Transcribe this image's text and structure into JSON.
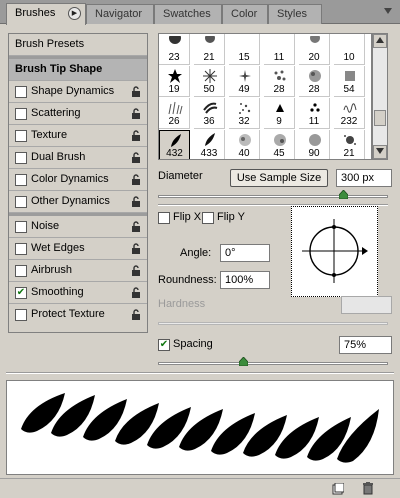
{
  "tabs": [
    {
      "label": "Brushes"
    },
    {
      "label": "Navigator"
    },
    {
      "label": "Swatches"
    },
    {
      "label": "Color"
    },
    {
      "label": "Styles"
    }
  ],
  "left_list": {
    "presets": "Brush Presets",
    "tip_shape": "Brush Tip Shape",
    "options": [
      {
        "label": "Shape Dynamics",
        "checked": false
      },
      {
        "label": "Scattering",
        "checked": false
      },
      {
        "label": "Texture",
        "checked": false
      },
      {
        "label": "Dual Brush",
        "checked": false
      },
      {
        "label": "Color Dynamics",
        "checked": false
      },
      {
        "label": "Other Dynamics",
        "checked": false
      }
    ],
    "options2": [
      {
        "label": "Noise",
        "checked": false
      },
      {
        "label": "Wet Edges",
        "checked": false
      },
      {
        "label": "Airbrush",
        "checked": false
      },
      {
        "label": "Smoothing",
        "checked": true
      },
      {
        "label": "Protect Texture",
        "checked": false
      }
    ]
  },
  "brush_grid": {
    "rows": [
      [
        "23",
        "21",
        "15",
        "11",
        "20",
        "10"
      ],
      [
        "19",
        "50",
        "49",
        "28",
        "28",
        "54"
      ],
      [
        "26",
        "36",
        "32",
        "9",
        "11",
        "232"
      ],
      [
        "432",
        "433",
        "40",
        "45",
        "90",
        "21"
      ]
    ],
    "selected": "432"
  },
  "diameter": {
    "label": "Diameter",
    "button": "Use Sample Size",
    "value": "300 px"
  },
  "flip_x": "Flip X",
  "flip_y": "Flip Y",
  "angle": {
    "label": "Angle:",
    "value": "0°"
  },
  "roundness": {
    "label": "Roundness:",
    "value": "100%"
  },
  "hardness": {
    "label": "Hardness",
    "value": ""
  },
  "spacing": {
    "label": "Spacing",
    "checked": true,
    "value": "75%"
  },
  "check_mark": "✔",
  "accent": "#117711"
}
